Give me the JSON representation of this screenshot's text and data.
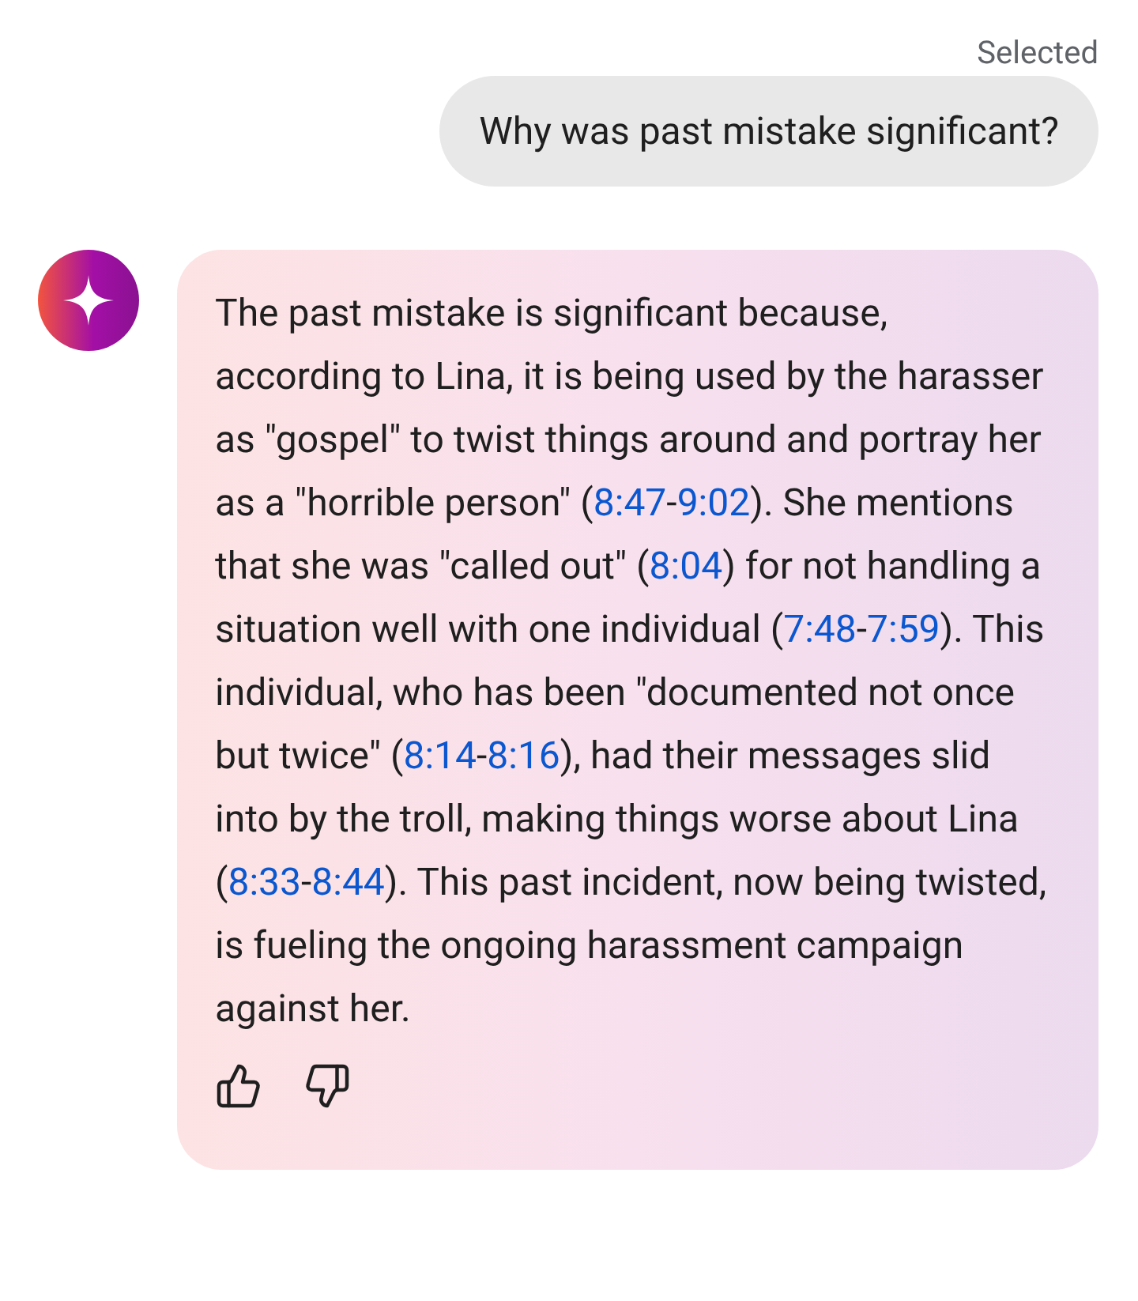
{
  "status_label": "Selected",
  "user_message": "Why was past mistake significant?",
  "response": {
    "segments": [
      {
        "kind": "text",
        "text": "The past mistake is significant because, according to Lina, it is being used by the harasser as \"gospel\" to twist things around and portray her as a \"horrible person\" ("
      },
      {
        "kind": "link",
        "text": "8:47"
      },
      {
        "kind": "text",
        "text": "-"
      },
      {
        "kind": "link",
        "text": "9:02"
      },
      {
        "kind": "text",
        "text": "). She mentions that she was \"called out\" ("
      },
      {
        "kind": "link",
        "text": "8:04"
      },
      {
        "kind": "text",
        "text": ") for not handling a situation well with one individual ("
      },
      {
        "kind": "link",
        "text": "7:48"
      },
      {
        "kind": "text",
        "text": "-"
      },
      {
        "kind": "link",
        "text": "7:59"
      },
      {
        "kind": "text",
        "text": "). This individual, who has been \"documented not once but twice\" ("
      },
      {
        "kind": "link",
        "text": "8:14"
      },
      {
        "kind": "text",
        "text": "-"
      },
      {
        "kind": "link",
        "text": "8:16"
      },
      {
        "kind": "text",
        "text": "), had their messages slid into by the troll, making things worse about Lina ("
      },
      {
        "kind": "link",
        "text": "8:33"
      },
      {
        "kind": "text",
        "text": "-"
      },
      {
        "kind": "link",
        "text": "8:44"
      },
      {
        "kind": "text",
        "text": "). This past incident, now being twisted, is fueling the ongoing harassment campaign against her."
      }
    ]
  }
}
